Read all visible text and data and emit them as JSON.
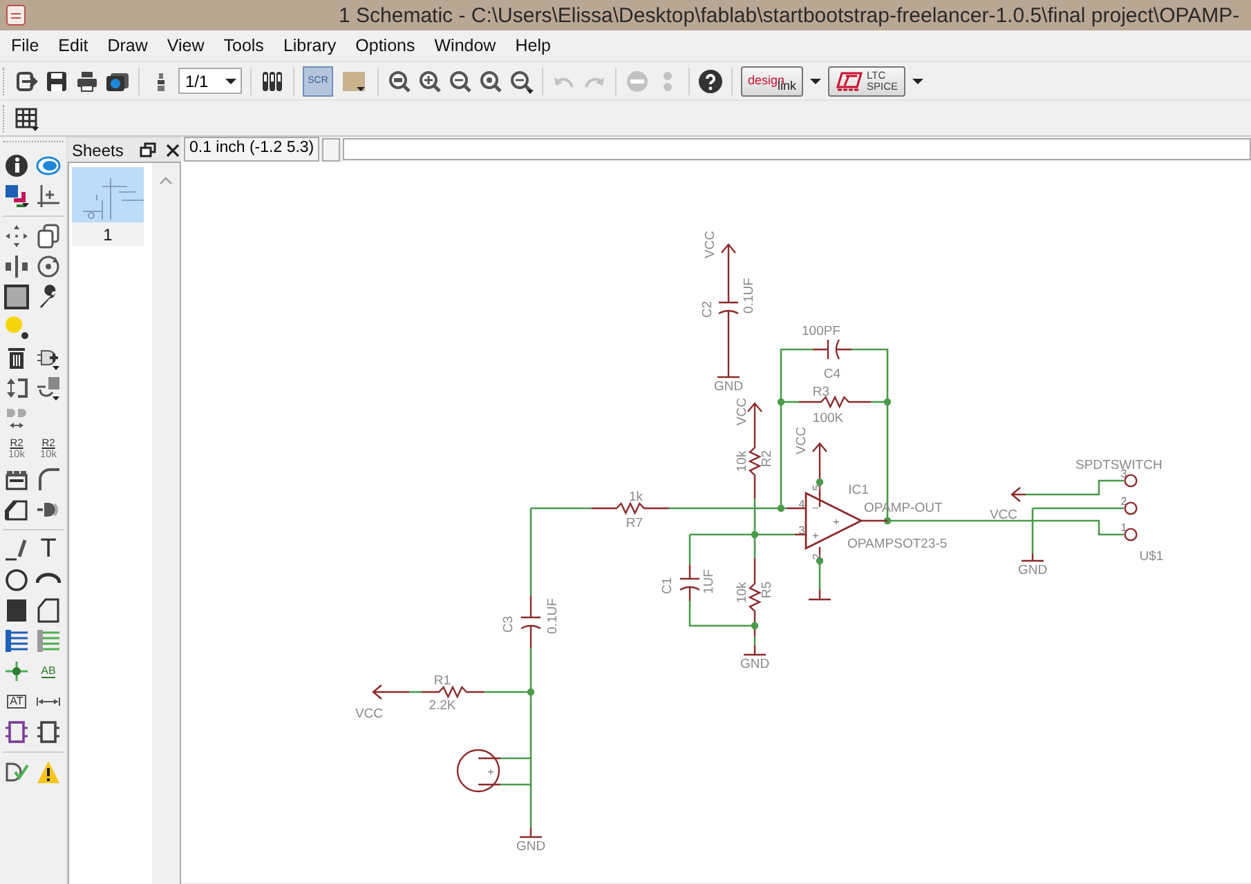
{
  "window": {
    "title": "1 Schematic - C:\\Users\\Elissa\\Desktop\\fablab\\startbootstrap-freelancer-1.0.5\\final project\\OPAMP-"
  },
  "menu": [
    "File",
    "Edit",
    "Draw",
    "View",
    "Tools",
    "Library",
    "Options",
    "Window",
    "Help"
  ],
  "toolbar": [
    {
      "kind": "open"
    },
    {
      "kind": "save"
    },
    {
      "kind": "print"
    },
    {
      "kind": "camera"
    },
    {
      "kind": "separator"
    },
    {
      "kind": "layers"
    },
    {
      "kind": "dropdown",
      "value": "1/1"
    },
    {
      "kind": "separator"
    },
    {
      "kind": "bars"
    },
    {
      "kind": "separator"
    },
    {
      "kind": "script",
      "label": "SCR",
      "selected": true
    },
    {
      "kind": "run",
      "selected": false
    },
    {
      "kind": "separator"
    },
    {
      "kind": "zoom-fit"
    },
    {
      "kind": "zoom-in"
    },
    {
      "kind": "zoom-out"
    },
    {
      "kind": "zoom-redraw"
    },
    {
      "kind": "zoom-select"
    },
    {
      "kind": "separator"
    },
    {
      "kind": "undo",
      "disabled": true
    },
    {
      "kind": "redo",
      "disabled": true
    },
    {
      "kind": "separator"
    },
    {
      "kind": "stop",
      "disabled": true
    },
    {
      "kind": "go",
      "disabled": true
    },
    {
      "kind": "separator"
    },
    {
      "kind": "help"
    },
    {
      "kind": "separator"
    },
    {
      "kind": "designlink",
      "label": "design",
      "sublabel": "link"
    },
    {
      "kind": "caret"
    },
    {
      "kind": "ltspice",
      "label": "LTC",
      "sublabel": "SPICE"
    },
    {
      "kind": "caret"
    }
  ],
  "toolbar2": [
    {
      "kind": "grid"
    }
  ],
  "toolbox": [
    {
      "rows": [
        [
          {
            "kind": "info"
          },
          {
            "kind": "show"
          }
        ],
        [
          {
            "kind": "display"
          },
          {
            "kind": "mark"
          }
        ]
      ]
    },
    {
      "rows": [
        [
          {
            "kind": "move"
          },
          {
            "kind": "copy"
          }
        ],
        [
          {
            "kind": "mirror"
          },
          {
            "kind": "rotate"
          }
        ],
        [
          {
            "kind": "group"
          },
          {
            "kind": "change"
          }
        ],
        [
          {
            "kind": "paste"
          }
        ],
        [
          {
            "kind": "delete"
          },
          {
            "kind": "add"
          }
        ],
        [
          {
            "kind": "pinswap"
          },
          {
            "kind": "replace"
          }
        ],
        [
          {
            "kind": "gateswap"
          }
        ],
        [
          {
            "kind": "name",
            "label": "R2",
            "sublabel": "10k"
          },
          {
            "kind": "value",
            "label": "R2",
            "sublabel": "10k"
          }
        ],
        [
          {
            "kind": "split"
          },
          {
            "kind": "miter"
          }
        ],
        [
          {
            "kind": "slope"
          },
          {
            "kind": "invoke"
          }
        ]
      ]
    },
    {
      "rows": [
        [
          {
            "kind": "line"
          },
          {
            "kind": "text",
            "label": "T"
          }
        ],
        [
          {
            "kind": "circle"
          },
          {
            "kind": "arc"
          }
        ],
        [
          {
            "kind": "rect"
          },
          {
            "kind": "polygon"
          }
        ],
        [
          {
            "kind": "bus"
          },
          {
            "kind": "net"
          }
        ],
        [
          {
            "kind": "junction"
          },
          {
            "kind": "label",
            "label": "AB"
          }
        ],
        [
          {
            "kind": "attribute",
            "label": "AT"
          },
          {
            "kind": "dimension"
          }
        ],
        [
          {
            "kind": "frame"
          },
          {
            "kind": "module"
          }
        ]
      ]
    },
    {
      "rows": [
        [
          {
            "kind": "erc"
          },
          {
            "kind": "warning"
          }
        ]
      ]
    }
  ],
  "sheets": {
    "title": "Sheets",
    "items": [
      {
        "label": "1",
        "selected": true
      }
    ]
  },
  "command": {
    "coordinates": "0.1 inch (-1.2 5.3)"
  },
  "schematic": {
    "labels": [
      "VCC",
      "C2",
      "0.1UF",
      "GND",
      "VCC",
      "10k",
      "R2",
      "100PF",
      "C4",
      "R3",
      "100K",
      "VCC",
      "IC1",
      "5",
      "4",
      "−",
      "3",
      "+",
      "+",
      "OPAMP-OUT",
      "2",
      "OPAMPSOT23-5",
      "SPDTSWITCH",
      "3",
      "2",
      "VCC",
      "1",
      "U$1",
      "GND",
      "1k",
      "R7",
      "C1",
      "1UF",
      "10k",
      "R5",
      "GND",
      "C3",
      "0.1UF",
      "R1",
      "VCC",
      "2.2K",
      "+",
      "GND"
    ]
  }
}
